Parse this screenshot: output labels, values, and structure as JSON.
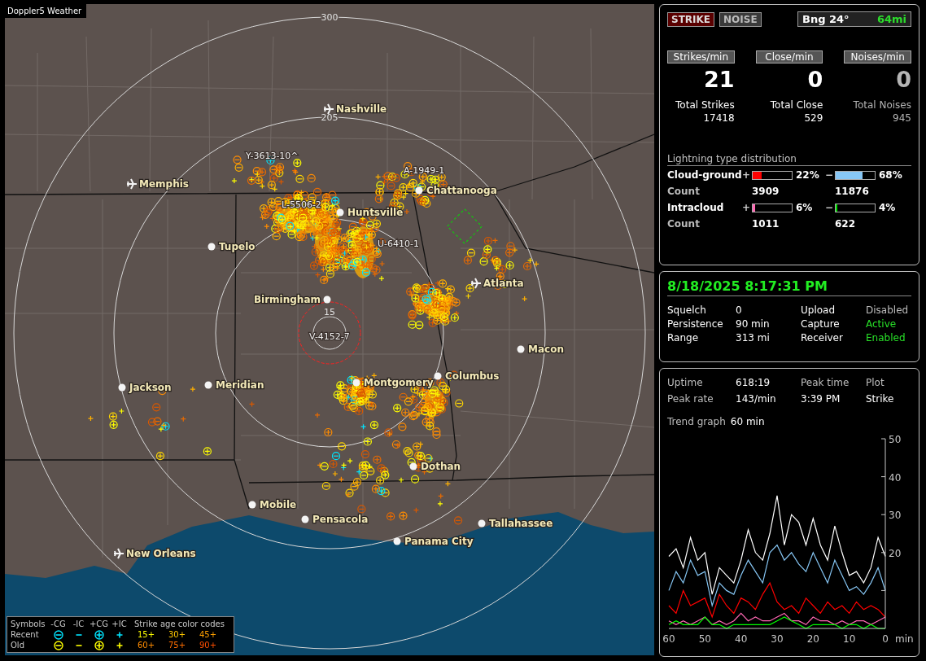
{
  "title": "Doppler5 Weather",
  "map": {
    "range_rings": [
      "300",
      "205",
      "15"
    ],
    "cities": [
      {
        "name": "Nashville",
        "kind": "airport"
      },
      {
        "name": "Memphis",
        "kind": "airport"
      },
      {
        "name": "Chattanooga",
        "kind": "city"
      },
      {
        "name": "Huntsville",
        "kind": "city"
      },
      {
        "name": "Tupelo",
        "kind": "city"
      },
      {
        "name": "Atlanta",
        "kind": "airport"
      },
      {
        "name": "Birmingham",
        "kind": "city"
      },
      {
        "name": "Macon",
        "kind": "city"
      },
      {
        "name": "Jackson",
        "kind": "city"
      },
      {
        "name": "Meridian",
        "kind": "city"
      },
      {
        "name": "Montgomery",
        "kind": "city"
      },
      {
        "name": "Columbus",
        "kind": "city"
      },
      {
        "name": "Dothan",
        "kind": "city"
      },
      {
        "name": "Mobile",
        "kind": "city"
      },
      {
        "name": "Pensacola",
        "kind": "city"
      },
      {
        "name": "Tallahassee",
        "kind": "city"
      },
      {
        "name": "Panama City",
        "kind": "city"
      },
      {
        "name": "New Orleans",
        "kind": "airport"
      }
    ],
    "storm_ids": [
      "Y-3613-10^",
      "A-1949-1",
      "L-5506-2",
      "U-6410-1",
      "V-4152-7"
    ],
    "legend": {
      "title": "Symbols",
      "age_title": "Strike age color codes",
      "columns": [
        {
          "label": "-CG",
          "kind": "ringminus"
        },
        {
          "label": "-IC",
          "kind": "minus"
        },
        {
          "label": "+CG",
          "kind": "ringplus"
        },
        {
          "label": "+IC",
          "kind": "plus"
        }
      ],
      "rows": [
        {
          "label": "Recent",
          "color": "#00e5ff",
          "ages": [
            {
              "text": "15+",
              "color": "#ffff00"
            },
            {
              "text": "30+",
              "color": "#ffc800"
            },
            {
              "text": "45+",
              "color": "#ffa000"
            }
          ]
        },
        {
          "label": "Old",
          "color": "#ffff00",
          "ages": [
            {
              "text": "60+",
              "color": "#ff8c00"
            },
            {
              "text": "75+",
              "color": "#ff6e00"
            },
            {
              "text": "90+",
              "color": "#ff4e00"
            }
          ]
        }
      ]
    }
  },
  "modes": [
    {
      "label": "STRIKE",
      "selected": true
    },
    {
      "label": "NOISE",
      "selected": false
    }
  ],
  "bearing": {
    "label": "Bng 24°",
    "distance": "64mi"
  },
  "stats": [
    {
      "label": "Strikes/min",
      "value": "21",
      "total_label": "Total Strikes",
      "total": "17418",
      "dimmed": false
    },
    {
      "label": "Close/min",
      "value": "0",
      "total_label": "Total Close",
      "total": "529",
      "dimmed": false
    },
    {
      "label": "Noises/min",
      "value": "0",
      "total_label": "Total Noises",
      "total": "945",
      "dimmed": true
    }
  ],
  "distribution": {
    "title": "Lightning type distribution",
    "rows": [
      {
        "name": "Cloud-ground",
        "count_label": "Count",
        "parts": [
          {
            "sign": "+",
            "level": 0.22,
            "percent": "22%",
            "color": "#ff0000",
            "count": "3909"
          },
          {
            "sign": "−",
            "level": 0.68,
            "percent": "68%",
            "color": "#87c7f5",
            "count": "11876"
          }
        ]
      },
      {
        "name": "Intracloud",
        "count_label": "Count",
        "parts": [
          {
            "sign": "+",
            "level": 0.06,
            "percent": "6%",
            "color": "#ff69b4",
            "count": "1011"
          },
          {
            "sign": "−",
            "level": 0.04,
            "percent": "4%",
            "color": "#00e000",
            "count": "622"
          }
        ]
      }
    ]
  },
  "status": {
    "datetime": "8/18/2025 8:17:31 PM",
    "rows": [
      {
        "label": "Squelch",
        "value": "0",
        "right_label": "Upload",
        "right_value": "Disabled",
        "on": false
      },
      {
        "label": "Persistence",
        "value": "90 min",
        "right_label": "Capture",
        "right_value": "Active",
        "on": true
      },
      {
        "label": "Range",
        "value": "313 mi",
        "right_label": "Receiver",
        "right_value": "Enabled",
        "on": true
      }
    ]
  },
  "summary": {
    "rows": [
      {
        "cells": [
          {
            "text": "Uptime",
            "kind": "label"
          },
          {
            "text": "618:19",
            "kind": "value"
          },
          {
            "text": "Peak time",
            "kind": "label"
          },
          {
            "text": "Plot",
            "kind": "label"
          }
        ]
      },
      {
        "cells": [
          {
            "text": "Peak rate",
            "kind": "label"
          },
          {
            "text": "143/min",
            "kind": "value"
          },
          {
            "text": "3:39 PM",
            "kind": "value"
          },
          {
            "text": "Strike",
            "kind": "value"
          }
        ]
      }
    ]
  },
  "trend": {
    "label": "Trend graph",
    "value": "60 min",
    "chart_data": {
      "type": "line",
      "xlabel": "min",
      "xlim": [
        60,
        0
      ],
      "ylim": [
        0,
        50
      ],
      "xticks": [
        60,
        50,
        40,
        30,
        20,
        10,
        0
      ],
      "yticks": [
        20,
        30,
        40,
        50
      ],
      "x": [
        60,
        58,
        56,
        54,
        52,
        50,
        48,
        46,
        44,
        42,
        40,
        38,
        36,
        34,
        32,
        30,
        28,
        26,
        24,
        22,
        20,
        18,
        16,
        14,
        12,
        10,
        8,
        6,
        4,
        2,
        0
      ],
      "series": [
        {
          "color": "#ffffff",
          "values": [
            19,
            21,
            16,
            24,
            18,
            20,
            9,
            16,
            14,
            12,
            18,
            26,
            20,
            18,
            25,
            35,
            22,
            30,
            28,
            22,
            29,
            22,
            18,
            27,
            20,
            14,
            15,
            12,
            16,
            24,
            19
          ]
        },
        {
          "color": "#87c7f5",
          "values": [
            10,
            15,
            12,
            18,
            14,
            15,
            6,
            12,
            10,
            9,
            14,
            18,
            15,
            12,
            20,
            22,
            18,
            20,
            17,
            15,
            20,
            16,
            12,
            18,
            14,
            10,
            11,
            9,
            12,
            16,
            10
          ]
        },
        {
          "color": "#ff0000",
          "values": [
            6,
            4,
            10,
            6,
            7,
            8,
            3,
            9,
            6,
            4,
            8,
            7,
            5,
            9,
            12,
            7,
            5,
            6,
            4,
            8,
            6,
            4,
            7,
            5,
            6,
            4,
            7,
            5,
            6,
            5,
            3
          ]
        },
        {
          "color": "#ff69b4",
          "values": [
            2,
            1,
            2,
            1,
            2,
            3,
            1,
            2,
            1,
            2,
            4,
            2,
            3,
            2,
            2,
            3,
            4,
            2,
            2,
            1,
            3,
            2,
            2,
            1,
            2,
            1,
            2,
            2,
            1,
            2,
            3
          ]
        },
        {
          "color": "#00ff00",
          "values": [
            1,
            2,
            1,
            1,
            1,
            3,
            1,
            1,
            0,
            1,
            1,
            1,
            1,
            1,
            1,
            2,
            3,
            2,
            1,
            0,
            1,
            1,
            1,
            1,
            0,
            1,
            1,
            0,
            1,
            0,
            0
          ]
        }
      ]
    }
  }
}
